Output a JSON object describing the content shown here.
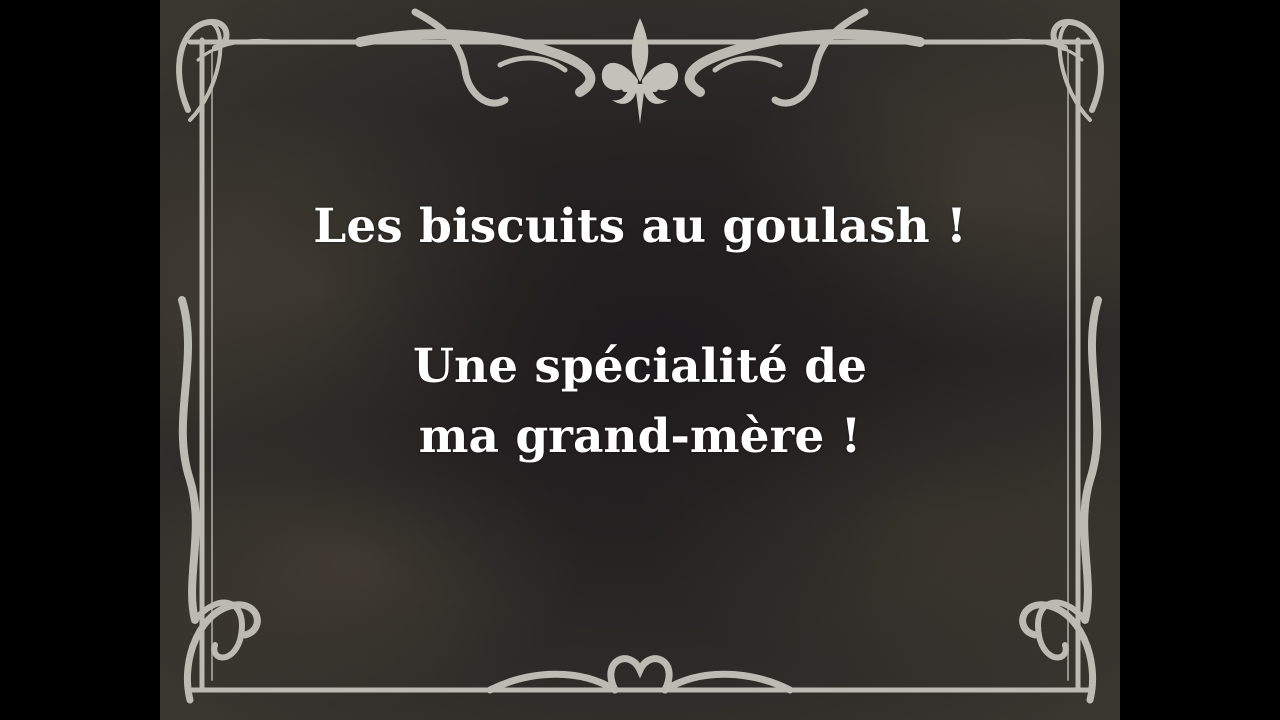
{
  "title_card": {
    "line1": "Les biscuits au goulash !",
    "line2": "Une spécialité de",
    "line3": "ma grand-mère !"
  },
  "colors": {
    "background": "#232122",
    "frame": "#bdbab3",
    "text": "#ffffff",
    "letterbox": "#000000"
  },
  "ornaments": [
    "fleur-de-lis-icon",
    "scroll-flourish-icon"
  ]
}
